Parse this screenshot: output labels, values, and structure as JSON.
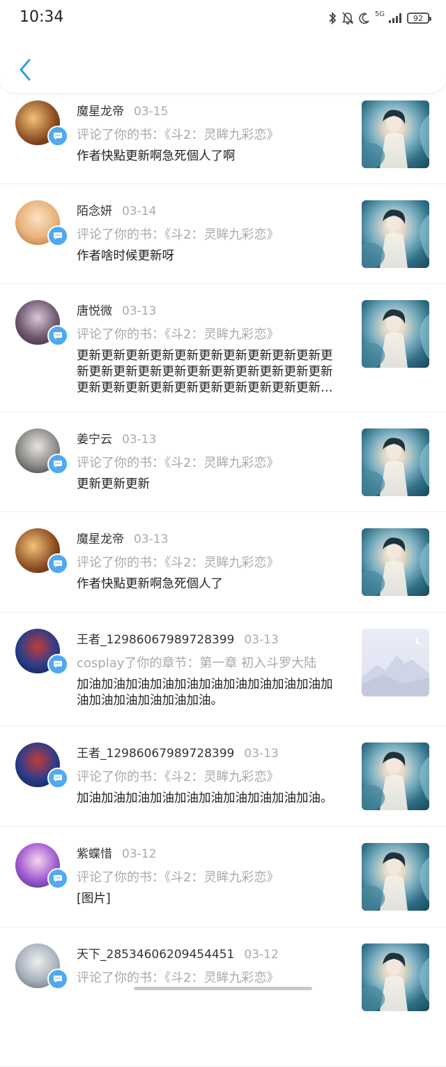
{
  "status": {
    "time": "10:34",
    "network": "5G",
    "battery": "92"
  },
  "items": [
    {
      "name": "魔星龙帝",
      "date": "03-15",
      "action": "评论了你的书：《斗2：灵眸九彩恋》",
      "content": "作者快點更新啊急死個人了啊",
      "thumb": "cover"
    },
    {
      "name": "陌念妍",
      "date": "03-14",
      "action": "评论了你的书：《斗2：灵眸九彩恋》",
      "content": "作者啥时候更新呀",
      "thumb": "cover"
    },
    {
      "name": "唐悦微",
      "date": "03-13",
      "action": "评论了你的书：《斗2：灵眸九彩恋》",
      "content": "更新更新更新更新更新更新更新更新更新更新更新更新更新更新更新更新更新更新更新更新更新更新更新更新更新更新更新更新更新更新更新更新更新更新更新更新更新更新更新",
      "thumb": "cover"
    },
    {
      "name": "姜宁云",
      "date": "03-13",
      "action": "评论了你的书：《斗2：灵眸九彩恋》",
      "content": "更新更新更新",
      "thumb": "cover"
    },
    {
      "name": "魔星龙帝",
      "date": "03-13",
      "action": "评论了你的书：《斗2：灵眸九彩恋》",
      "content": "作者快點更新啊急死個人了",
      "thumb": "cover"
    },
    {
      "name": "王者_12986067989728399",
      "date": "03-13",
      "action": "cosplay了你的章节：第一章 初入斗罗大陆",
      "content": "加油加油加油加油加油加油加油加油加油加油加油加油加油加油加油加油。",
      "thumb": "placeholder"
    },
    {
      "name": "王者_12986067989728399",
      "date": "03-13",
      "action": "评论了你的书：《斗2：灵眸九彩恋》",
      "content": "加油加油加油加油加油加油加油加油加油加油。",
      "thumb": "cover"
    },
    {
      "name": "紫蝶惜",
      "date": "03-12",
      "action": "评论了你的书：《斗2：灵眸九彩恋》",
      "content": "[图片]",
      "thumb": "cover"
    },
    {
      "name": "天下_28534606209454451",
      "date": "03-12",
      "action": "评论了你的书：《斗2：灵眸九彩恋》",
      "content": "",
      "thumb": "cover"
    }
  ]
}
